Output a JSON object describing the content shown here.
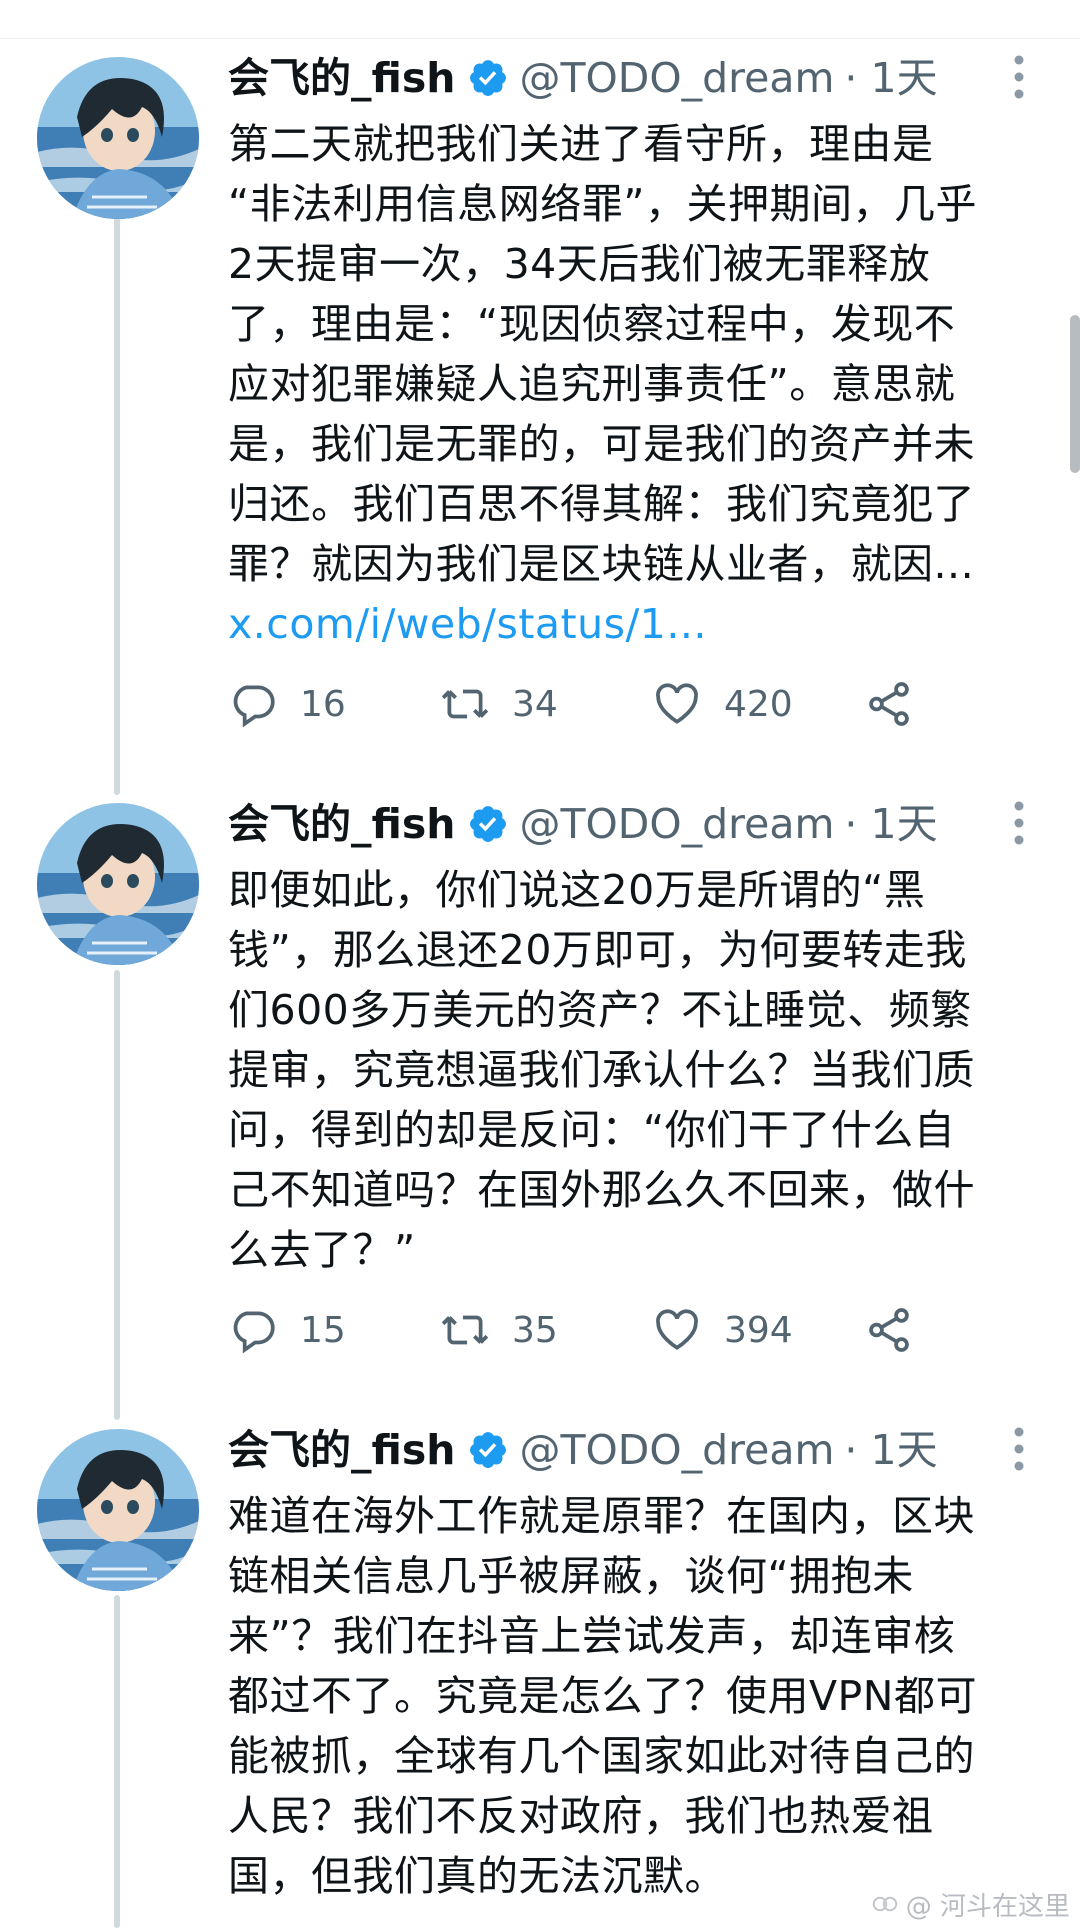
{
  "author": {
    "name": "会飞的_fish",
    "handle": "@TODO_dream",
    "time": "· 1天"
  },
  "icons": {
    "verified": "verified-badge-icon",
    "more": "more-vertical-icon",
    "reply": "reply-icon",
    "retweet": "retweet-icon",
    "like": "heart-icon",
    "share": "share-icon"
  },
  "colors": {
    "verified": "#1d9bf0",
    "link": "#1d9bf0",
    "secondary": "#536471",
    "thread_line": "#cfd9de"
  },
  "tweets": [
    {
      "text": "第二天就把我们关进了看守所，理由是\n“非法利用信息网络罪”，关押期间，几乎\n2天提审一次，34天后我们被无罪释放\n了，理由是：“现因侦察过程中，发现不\n应对犯罪嫌疑人追究刑事责任”。意思就\n是，我们是无罪的，可是我们的资产并未\n归还。我们百思不得其解：我们究竟犯了\n罪？就因为我们是区块链从业者，就因...",
      "link": "x.com/i/web/status/1...",
      "replies": "16",
      "retweets": "34",
      "likes": "420"
    },
    {
      "text": "即便如此，你们说这20万是所谓的“黑\n钱”，那么退还20万即可，为何要转走我\n们600多万美元的资产？不让睡觉、频繁\n提审，究竟想逼我们承认什么？当我们质\n问，得到的却是反问：“你们干了什么自\n己不知道吗？在国外那么久不回来，做什\n么去了？”",
      "replies": "15",
      "retweets": "35",
      "likes": "394"
    },
    {
      "text": "难道在海外工作就是原罪？在国内，区块\n链相关信息几乎被屏蔽，谈何“拥抱未\n来”？我们在抖音上尝试发声，却连审核\n都过不了。究竟是怎么了？使用VPN都可\n能被抓，全球有几个国家如此对待自己的\n人民？我们不反对政府，我们也热爱祖\n国，但我们真的无法沉默。"
    }
  ],
  "watermark": "@ 河斗在这里"
}
